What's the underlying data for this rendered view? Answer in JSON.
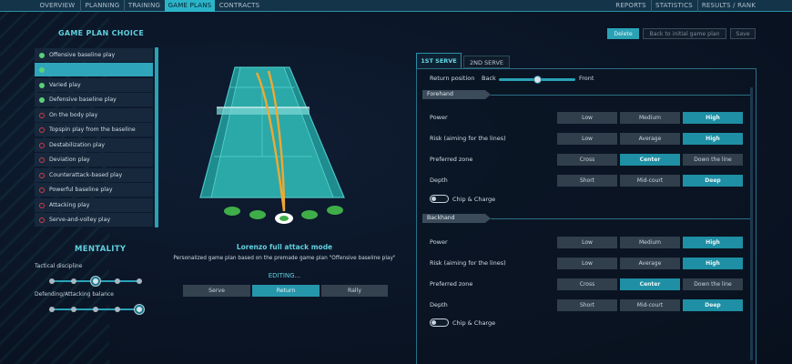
{
  "nav": {
    "left_tabs": [
      {
        "label": "OVERVIEW",
        "active": false
      },
      {
        "label": "PLANNING",
        "active": false
      },
      {
        "label": "TRAINING",
        "active": false
      },
      {
        "label": "GAME PLANS",
        "active": true
      },
      {
        "label": "CONTRACTS",
        "active": false
      }
    ],
    "right_tabs": [
      {
        "label": "REPORTS"
      },
      {
        "label": "STATISTICS"
      },
      {
        "label": "RESULTS / RANK"
      }
    ]
  },
  "game_plan_choice": {
    "title": "GAME PLAN CHOICE",
    "items": [
      {
        "label": "Offensive baseline play",
        "state": "on",
        "selected": false
      },
      {
        "label": "",
        "state": "on",
        "selected": true
      },
      {
        "label": "Varied play",
        "state": "on",
        "selected": false
      },
      {
        "label": "Defensive baseline play",
        "state": "on",
        "selected": false
      },
      {
        "label": "On the body play",
        "state": "off",
        "selected": false
      },
      {
        "label": "Topspin play from the baseline",
        "state": "off",
        "selected": false
      },
      {
        "label": "Destabilization play",
        "state": "off",
        "selected": false
      },
      {
        "label": "Deviation play",
        "state": "off",
        "selected": false
      },
      {
        "label": "Counterattack-based play",
        "state": "off",
        "selected": false
      },
      {
        "label": "Powerful baseline play",
        "state": "off",
        "selected": false
      },
      {
        "label": "Attacking play",
        "state": "off",
        "selected": false
      },
      {
        "label": "Serve-and-volley play",
        "state": "off",
        "selected": false
      }
    ]
  },
  "mentality": {
    "title": "MENTALITY",
    "sliders": [
      {
        "label": "Tactical discipline",
        "steps": 5,
        "selected_index": 2
      },
      {
        "label": "Defending/Attacking balance",
        "steps": 5,
        "selected_index": 4
      }
    ]
  },
  "center": {
    "plan_name": "Lorenzo full attack mode",
    "description": "Personalized game plan based on the premade game plan \"Offensive baseline play\"",
    "editing_label": "EDITING...",
    "modes": [
      {
        "label": "Serve",
        "active": false
      },
      {
        "label": "Return",
        "active": true
      },
      {
        "label": "Rally",
        "active": false
      }
    ]
  },
  "actions": {
    "delete": "Delete",
    "back_to_initial": "Back to initial game plan",
    "save": "Save"
  },
  "serve_tabs": [
    {
      "label": "1ST SERVE",
      "active": true
    },
    {
      "label": "2ND SERVE",
      "active": false
    }
  ],
  "return_position": {
    "label": "Return position",
    "left": "Back",
    "right": "Front",
    "value_fraction": 0.5
  },
  "forehand": {
    "title": "Forehand",
    "rows": [
      {
        "label": "Power",
        "options": [
          "Low",
          "Medium",
          "High"
        ],
        "selected": 2
      },
      {
        "label": "Risk (aiming for the lines)",
        "options": [
          "Low",
          "Average",
          "High"
        ],
        "selected": 2
      },
      {
        "label": "Preferred zone",
        "options": [
          "Cross",
          "Center",
          "Down the line"
        ],
        "selected": 1
      },
      {
        "label": "Depth",
        "options": [
          "Short",
          "Mid-court",
          "Deep"
        ],
        "selected": 2
      }
    ],
    "chip_charge": "Chip & Charge"
  },
  "backhand": {
    "title": "Backhand",
    "rows": [
      {
        "label": "Power",
        "options": [
          "Low",
          "Medium",
          "High"
        ],
        "selected": 2
      },
      {
        "label": "Risk (aiming for the lines)",
        "options": [
          "Low",
          "Average",
          "High"
        ],
        "selected": 2
      },
      {
        "label": "Preferred zone",
        "options": [
          "Cross",
          "Center",
          "Down the line"
        ],
        "selected": 1
      },
      {
        "label": "Depth",
        "options": [
          "Short",
          "Mid-court",
          "Deep"
        ],
        "selected": 2
      }
    ],
    "chip_charge": "Chip & Charge"
  },
  "colors": {
    "accent": "#2aa2b6",
    "court": "#2aa9a8",
    "trajectory": "#f0a832",
    "target_green": "#3fae49"
  }
}
